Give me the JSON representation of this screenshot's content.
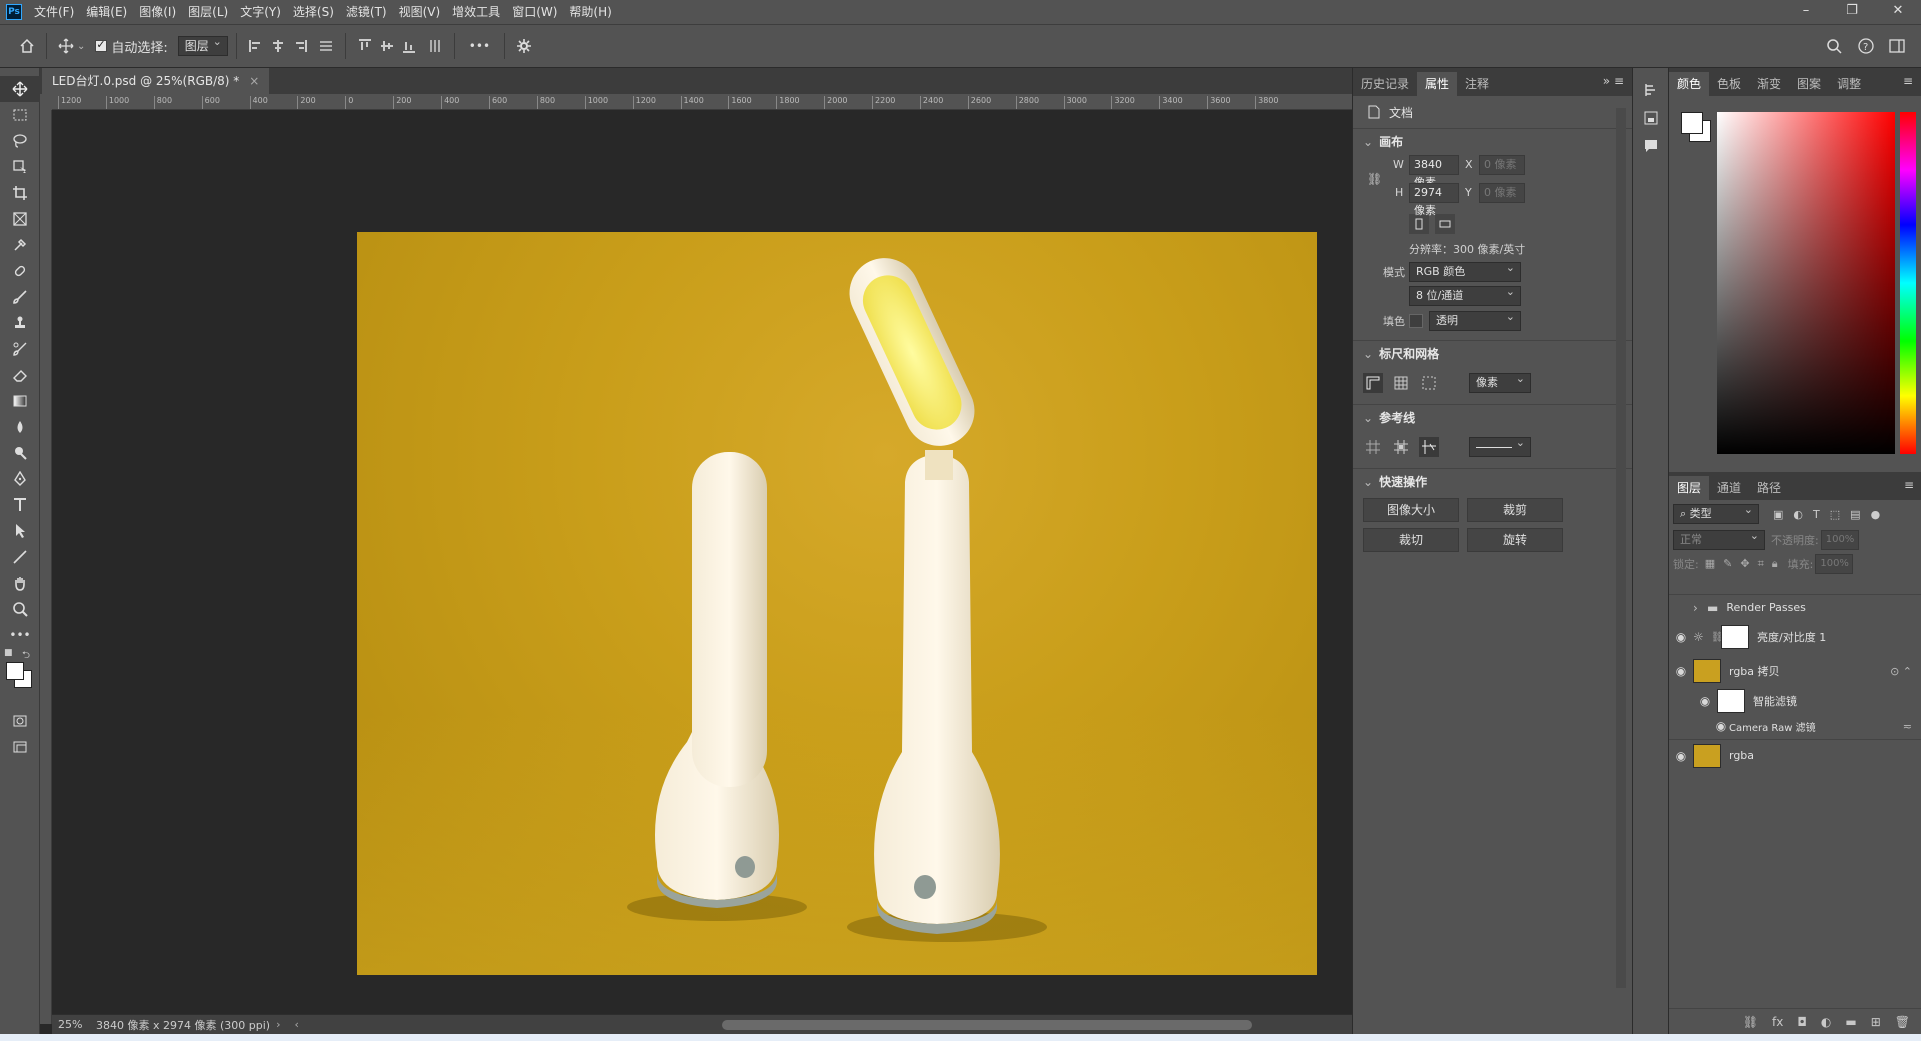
{
  "app": {
    "logo": "Ps"
  },
  "menu": [
    "文件(F)",
    "编辑(E)",
    "图像(I)",
    "图层(L)",
    "文字(Y)",
    "选择(S)",
    "滤镜(T)",
    "视图(V)",
    "增效工具",
    "窗口(W)",
    "帮助(H)"
  ],
  "window": {
    "minimize": "–",
    "restore": "❐",
    "close": "✕"
  },
  "options": {
    "auto_select_label": "自动选择:",
    "auto_select_target": "图层",
    "more": "•••"
  },
  "document": {
    "tab_title": "LED台灯.0.psd @ 25%(RGB/8) *",
    "close_glyph": "×",
    "zoom": "25%",
    "status_info": "3840 像素 x 2974 像素 (300 ppi)",
    "ruler_labels": [
      "1200",
      "1000",
      "800",
      "600",
      "400",
      "200",
      "0",
      "200",
      "400",
      "600",
      "800",
      "1000",
      "1200",
      "1400",
      "1600",
      "1800",
      "2000",
      "2200",
      "2400",
      "2600",
      "2800",
      "3000",
      "3200",
      "3400",
      "3600",
      "3800"
    ]
  },
  "props_panel": {
    "tabs": [
      "历史记录",
      "属性",
      "注释"
    ],
    "active_tab": "属性",
    "doc_label": "文档",
    "canvas": {
      "title": "画布",
      "w_label": "W",
      "w_value": "3840 像素",
      "h_label": "H",
      "h_value": "2974 像素",
      "x_label": "X",
      "x_value": "0 像素",
      "y_label": "Y",
      "y_value": "0 像素",
      "resolution": "分辨率：300 像素/英寸",
      "mode_label": "模式",
      "mode_value": "RGB 颜色",
      "depth_value": "8 位/通道",
      "fill_label": "填色",
      "fill_value": "透明"
    },
    "rulers": {
      "title": "标尺和网格",
      "unit": "像素"
    },
    "guides": {
      "title": "参考线"
    },
    "quick": {
      "title": "快速操作",
      "image_size": "图像大小",
      "crop": "裁剪",
      "trim": "裁切",
      "rotate": "旋转"
    }
  },
  "color_panel": {
    "tabs": [
      "颜色",
      "色板",
      "渐变",
      "图案",
      "调整"
    ]
  },
  "layers_panel": {
    "tabs": [
      "图层",
      "通道",
      "路径"
    ],
    "filter_label": "类型",
    "blend_mode": "正常",
    "opacity_label": "不透明度:",
    "opacity_value": "100%",
    "lock_label": "锁定:",
    "fill_label": "填充:",
    "fill_value": "100%",
    "layers": [
      {
        "name": "Render Passes"
      },
      {
        "name": "亮度/对比度 1"
      },
      {
        "name": "rgba 拷贝"
      },
      {
        "name": "智能滤镜"
      },
      {
        "name": "Camera Raw 滤镜"
      },
      {
        "name": "rgba"
      }
    ]
  }
}
